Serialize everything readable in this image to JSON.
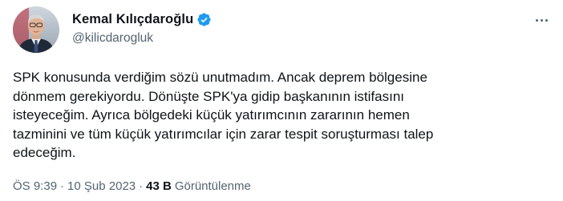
{
  "author": {
    "display_name": "Kemal Kılıçdaroğlu",
    "handle": "@kilicdarogluk",
    "verified": true,
    "verified_color": "#1d9bf0"
  },
  "more_menu_icon": "three-dots-icon",
  "tweet": {
    "text": "SPK konusunda verdiğim sözü unutmadım. Ancak deprem bölgesine\ndönmem gerekiyordu. Dönüşte SPK'ya gidip başkanının istifasını\nisteyeceğim. Ayrıca bölgedeki küçük yatırımcının zararının hemen\ntazminini ve tüm küçük yatırımcılar için zarar tespit soruşturması talep\nedeceğim."
  },
  "meta": {
    "time": "ÖS 9:39",
    "separator": "·",
    "date": "10 Şub 2023",
    "views_count": "43 B",
    "views_label": "Görüntülenme"
  }
}
